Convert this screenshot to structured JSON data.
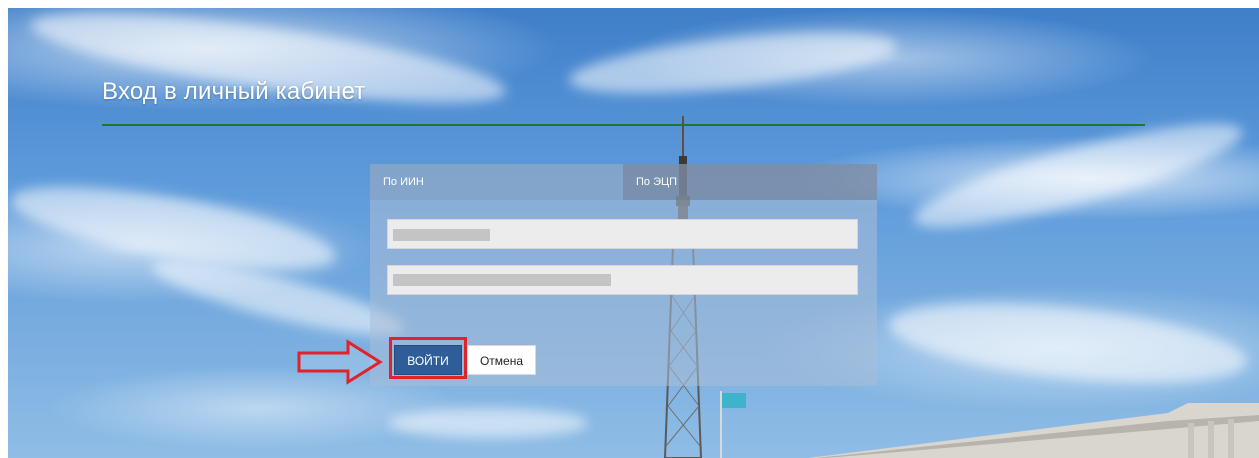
{
  "page": {
    "title": "Вход в личный кабинет"
  },
  "login_form": {
    "tabs": [
      {
        "label": "По ИИН",
        "active": false
      },
      {
        "label": "По ЭЦП",
        "active": true
      }
    ],
    "login_field": {
      "value": "",
      "redacted": true
    },
    "password_field": {
      "value": "",
      "redacted": true
    },
    "submit_label": "ВОЙТИ",
    "cancel_label": "Отмена"
  },
  "annotations": {
    "highlight_color": "#e0222a",
    "arrow_direction": "right"
  },
  "colors": {
    "accent_line": "#1d7a2c",
    "primary_button": "#2f5d9a",
    "sky": "#5b98da"
  }
}
